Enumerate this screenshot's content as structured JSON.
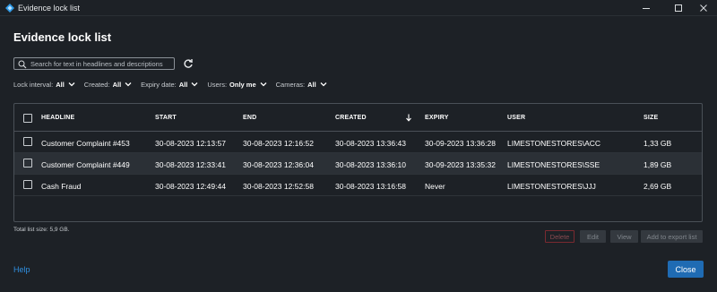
{
  "window": {
    "title": "Evidence lock list",
    "icon": "milestone-app-icon"
  },
  "heading": "Evidence lock list",
  "search": {
    "placeholder": "Search for text in headlines and descriptions",
    "value": ""
  },
  "filters": [
    {
      "label": "Lock interval:",
      "value": "All"
    },
    {
      "label": "Created:",
      "value": "All"
    },
    {
      "label": "Expiry date:",
      "value": "All"
    },
    {
      "label": "Users:",
      "value": "Only me"
    },
    {
      "label": "Cameras:",
      "value": "All"
    }
  ],
  "table": {
    "columns": [
      "HEADLINE",
      "START",
      "END",
      "CREATED",
      "EXPIRY",
      "USER",
      "SIZE"
    ],
    "sort": {
      "column": "CREATED",
      "direction": "descending"
    },
    "rows": [
      {
        "headline": "Customer Complaint #453",
        "start": "30-08-2023 12:13:57",
        "end": "30-08-2023 12:16:52",
        "created": "30-08-2023 13:36:43",
        "expiry": "30-09-2023 13:36:28",
        "user": "LIMESTONESTORES\\ACC",
        "size": "1,33 GB"
      },
      {
        "headline": "Customer Complaint #449",
        "start": "30-08-2023 12:33:41",
        "end": "30-08-2023 12:36:04",
        "created": "30-08-2023 13:36:10",
        "expiry": "30-09-2023 13:35:32",
        "user": "LIMESTONESTORES\\SSE",
        "size": "1,89 GB"
      },
      {
        "headline": "Cash Fraud",
        "start": "30-08-2023 12:49:44",
        "end": "30-08-2023 12:52:58",
        "created": "30-08-2023 13:16:58",
        "expiry": "Never",
        "user": "LIMESTONESTORES\\JJJ",
        "size": "2,69 GB"
      }
    ]
  },
  "total": "Total list size: 5,9 GB.",
  "actions": {
    "delete": "Delete",
    "edit": "Edit",
    "view": "View",
    "export": "Add to export list"
  },
  "footer": {
    "help": "Help",
    "close": "Close"
  },
  "colors": {
    "background": "#1d2126",
    "accent": "#1f6bb3",
    "link": "#2f8fe0",
    "delete_border": "#7a2a30",
    "selected_row": "#2b3036"
  }
}
